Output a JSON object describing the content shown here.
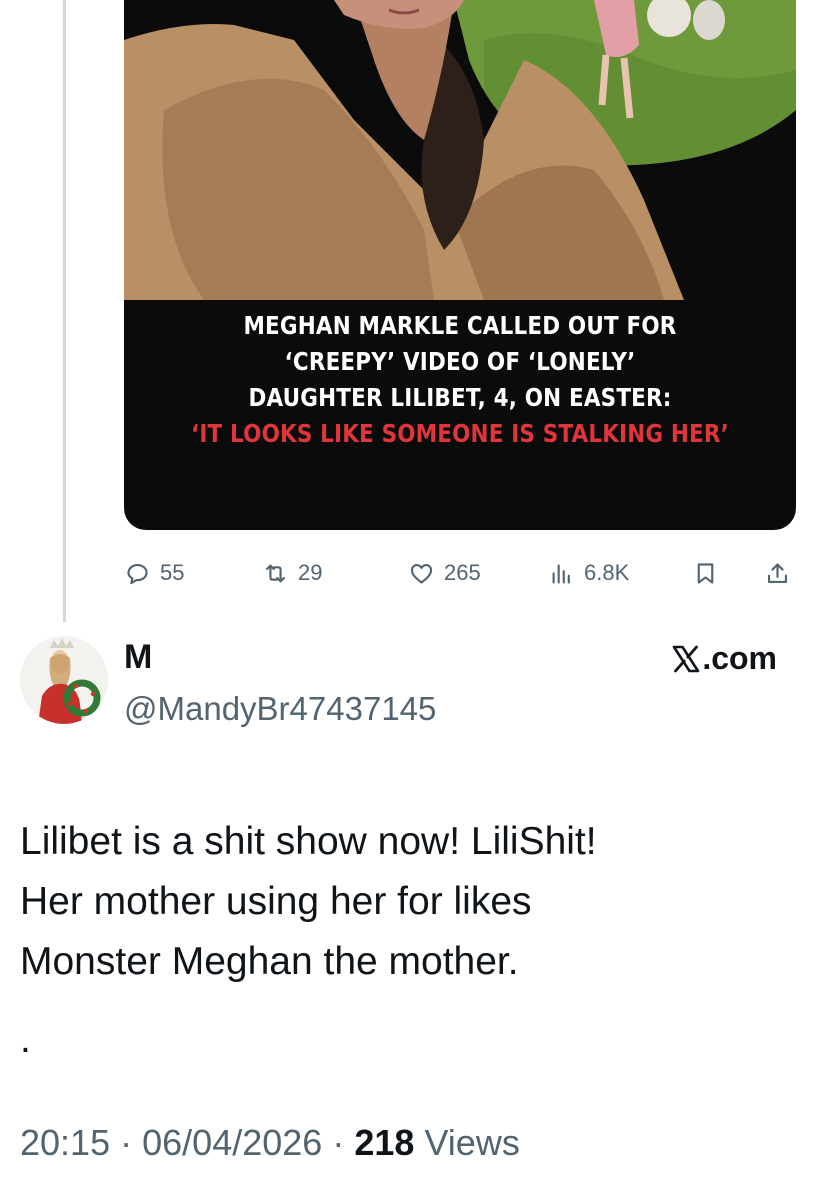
{
  "quoted_post": {
    "headline": {
      "line1": "MEGHAN MARKLE CALLED OUT FOR",
      "line2": "‘CREEPY’ VIDEO OF ‘LONELY’",
      "line3": "DAUGHTER LILIBET, 4, ON EASTER:",
      "line4": "‘IT LOOKS LIKE SOMEONE IS STALKING HER’"
    },
    "colors": {
      "headline_highlight": "#e0353a",
      "card_background": "#0b0b0b"
    },
    "actions": {
      "replies": "55",
      "reposts": "29",
      "likes": "265",
      "views": "6.8K"
    }
  },
  "post": {
    "display_name": "M",
    "handle": "@MandyBr47437145",
    "brand": ".com",
    "text_lines": [
      "Lilibet is a shit show now!  LiliShit!",
      "Her mother using her for likes",
      "Monster Meghan the mother."
    ],
    "trailing_mark": ".",
    "time": "20:15",
    "date": "06/04/2026",
    "separator": "·",
    "views_count": "218",
    "views_label": "Views"
  },
  "icons": {
    "reply": "speech-bubble-icon",
    "repost": "repost-arrows-icon",
    "like": "heart-icon",
    "views": "bar-chart-icon",
    "bookmark": "bookmark-icon",
    "share": "share-upload-icon",
    "brand": "x-logo-icon"
  }
}
